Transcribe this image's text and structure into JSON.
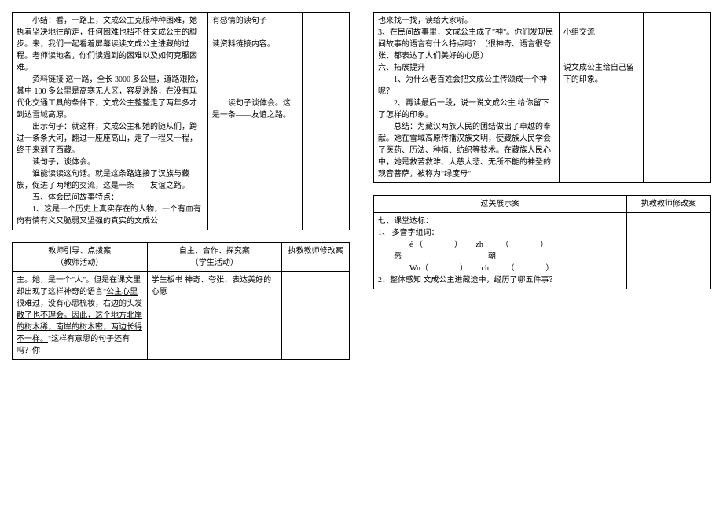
{
  "topLeft": {
    "col1": "　　小结：看，一路上，文成公主克服种种困难，她执着坚决地往前走，任何困难也挡不住文成公主的脚步。来，我们一起看着屏幕读读文成公主进藏的过程。老师读地名，你们读遇到的困难以及如何克服困难。\n　　资料链接 这一路，全长 3000 多公里，道路艰险，其中 100 多公里是高寒无人区，容易迷路，在没有现代化交通工具的条件下，文成公主整整走了两年多才到达雪域高原。\n　　出示句子：就这样，文成公主和她的随从们，跨过一条条大河，翻过一座座高山，走了一程又一程，终于来到了西藏。\n　　读句子，谈体会。\n　　谁能读读这句话。就是这条路连接了汉族与藏族，促进了两地的交流，这是一条——友谊之路。\n　　五、体会民间故事特点：\n　　1、这是一个历史上真实存在的人物，一个有血有肉有情有义又脆弱又坚强的真实的文成公",
    "col2": "有感情的读句子\n\n读资料链接内容。\n\n\n\n\n　　读句子谈体会。这是一条——友谊之路。",
    "col3": ""
  },
  "topRight": {
    "col1": "也来找一找，读给大家听。\n3、在民间故事里，文成公主成了\"神\"。你们发现民间故事的语言有什么特点吗？（很神奇、语言很夸张、都表达了人们美好的心愿）\n六、拓展提升\n　　1、为什么老百姓会把文成公主传颂成一个神呢？\n　　2、再读最后一段，说一说文成公主 给你留下了怎样的印象。\n　　总结：为藏汉两族人民的团结做出了卓越的奉献。她在雪域高原传播汉族文明，使藏族人民学会了医药、历法、种植、纺织等技术。在藏族人民心中，她是救苦救难、大慈大悲、无所不能的神圣的观音菩萨，被称为\"绿度母\"",
    "col2": "\n小组交流\n\n\n说文成公主给自己留下的印象。",
    "col3": ""
  },
  "bottomLeft": {
    "header1": "教师引导、点拨案\n（教师活动）",
    "header2": "自主、合作、探究案\n（学生活动）",
    "header3": "执教教师修改案",
    "col1": "主。她，是一个\"人\"。但是在课文里却出现了这样神奇的语言\"公主心里很难过，没有心思梳妆，右边的头发散了也不理会。因此，这个地方北岸的树木稀，南岸的树木密，两边长得不一样。\"这样有意思的句子还有吗？你",
    "col2": "学生板书 神奇、夸张、表达美好的心愿",
    "col3": ""
  },
  "bottomRight": {
    "header1": "过关展示案",
    "header2": "执教教师修改案",
    "col1": "七、课堂达标：\n1、 多音字组词：\n　　　　é （　　　　）　　 zh　　 （　　　　）\n　　恶　　　　　　　　　　　朝\n　　　　Wu（　　　　）　　 ch　　 （　　　　）\n2、整体感知 文成公主进藏途中，经历了哪五件事？",
    "col2": ""
  }
}
